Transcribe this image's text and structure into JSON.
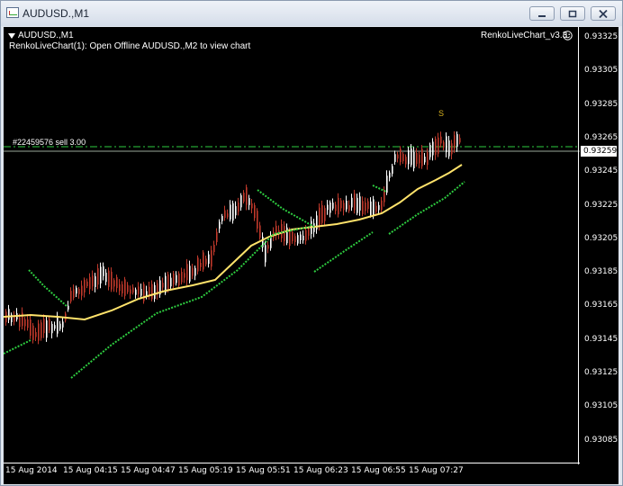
{
  "window": {
    "title": "AUDUSD.,M1",
    "buttons": {
      "minimize": "minimize",
      "restore": "restore",
      "close": "close"
    }
  },
  "chart": {
    "symbol": "AUDUSD.,M1",
    "message": "RenkoLiveChart(1): Open Offline AUDUSD.,M2 to view chart",
    "indicator": "RenkoLiveChart_v3.3",
    "order_label": "#22459576 sell 3.00",
    "signal_marker": "S",
    "current_price": "0.93259",
    "price_ticks": [
      "0.93325",
      "0.93305",
      "0.93285",
      "0.93265",
      "0.93245",
      "0.93225",
      "0.93205",
      "0.93185",
      "0.93165",
      "0.93145",
      "0.93125",
      "0.93105",
      "0.93085"
    ],
    "time_ticks": [
      "15 Aug 2014",
      "15 Aug 04:15",
      "15 Aug 04:47",
      "15 Aug 05:19",
      "15 Aug 05:51",
      "15 Aug 06:23",
      "15 Aug 06:55",
      "15 Aug 07:27"
    ],
    "colors": {
      "background": "#000000",
      "bull": "#ffffff",
      "bear": "#c0392b",
      "ma": "#ffe36b",
      "trail": "#2ecc40",
      "order_line": "#2ecc40",
      "marker": "#d8b21f"
    }
  }
}
